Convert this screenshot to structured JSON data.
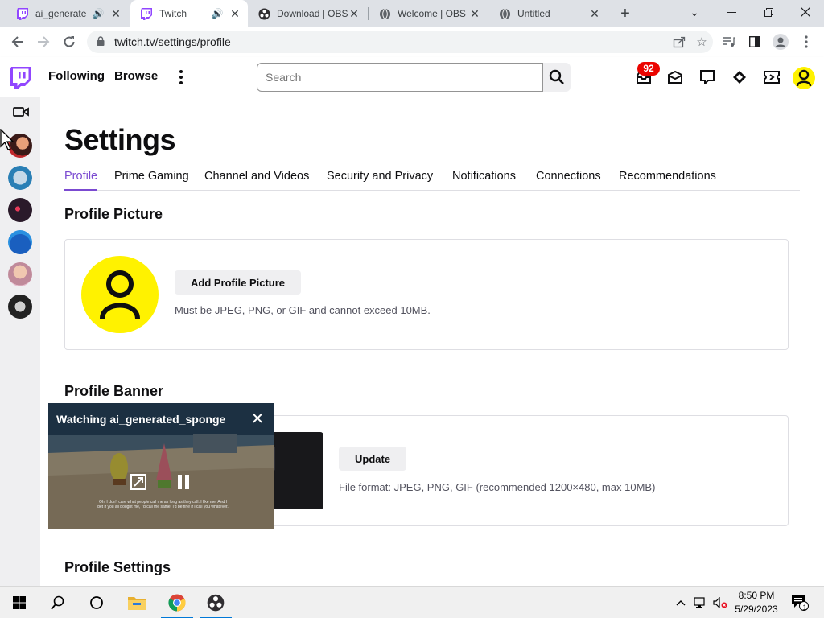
{
  "browser": {
    "tabs": [
      {
        "title": "ai_generate",
        "favicon": "twitch-icon",
        "audio": true,
        "active": false
      },
      {
        "title": "Twitch",
        "favicon": "twitch-icon",
        "audio": true,
        "active": true
      },
      {
        "title": "Download | OBS",
        "favicon": "obs-icon",
        "audio": false,
        "active": false
      },
      {
        "title": "Welcome | OBS",
        "favicon": "globe-icon",
        "audio": false,
        "active": false
      },
      {
        "title": "Untitled",
        "favicon": "globe-icon",
        "audio": false,
        "active": false
      }
    ],
    "url": "twitch.tv/settings/profile"
  },
  "twitch": {
    "nav": {
      "following": "Following",
      "browse": "Browse",
      "search_placeholder": "Search",
      "notification_count": "92"
    },
    "settings": {
      "title": "Settings",
      "tabs": [
        "Profile",
        "Prime Gaming",
        "Channel and Videos",
        "Security and Privacy",
        "Notifications",
        "Connections",
        "Recommendations"
      ],
      "active_tab": "Profile",
      "profile_picture": {
        "heading": "Profile Picture",
        "button": "Add Profile Picture",
        "hint": "Must be JPEG, PNG, or GIF and cannot exceed 10MB."
      },
      "profile_banner": {
        "heading": "Profile Banner",
        "button": "Update",
        "hint": "File format: JPEG, PNG, GIF (recommended 1200×480, max 10MB)"
      },
      "profile_settings": {
        "heading": "Profile Settings"
      }
    },
    "mini_player": {
      "title": "Watching ai_generated_sponge",
      "caption": "Oh, I don't care what people call me as long as they call. I like me. And I bet if you all bought me, I'd call the same. I'd be fine if I call you whatever."
    },
    "colors": {
      "brand": "#9146ff",
      "active_tab": "#7b4ad1",
      "avatar_bg": "#fff200",
      "badge": "#eb0400"
    }
  },
  "taskbar": {
    "time": "8:50 PM",
    "date": "5/29/2023",
    "notification_count": "1"
  }
}
